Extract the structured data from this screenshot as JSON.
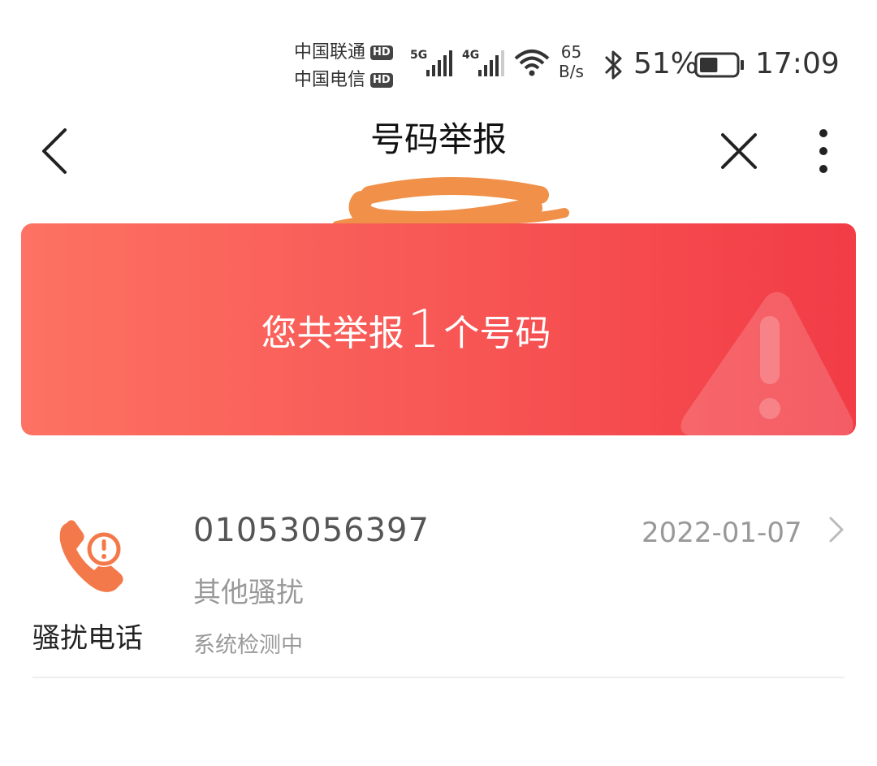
{
  "status_bar": {
    "carrier1": "中国联通",
    "carrier2": "中国电信",
    "hd_badge": "HD",
    "sig1_type": "5G",
    "sig2_type": "4G",
    "net_speed_value": "65",
    "net_speed_unit": "B/s",
    "battery_percent": "51%",
    "battery_level": 0.51,
    "time": "17:09"
  },
  "header": {
    "title": "号码举报"
  },
  "banner": {
    "prefix": "您共举报",
    "count": "1",
    "suffix": "个号码"
  },
  "reports": [
    {
      "category": "骚扰电话",
      "number": "01053056397",
      "date": "2022-01-07",
      "reason": "其他骚扰",
      "status": "系统检测中"
    }
  ],
  "colors": {
    "banner_start": "#fd7262",
    "banner_end": "#f23c46",
    "icon_orange": "#f4794a"
  }
}
